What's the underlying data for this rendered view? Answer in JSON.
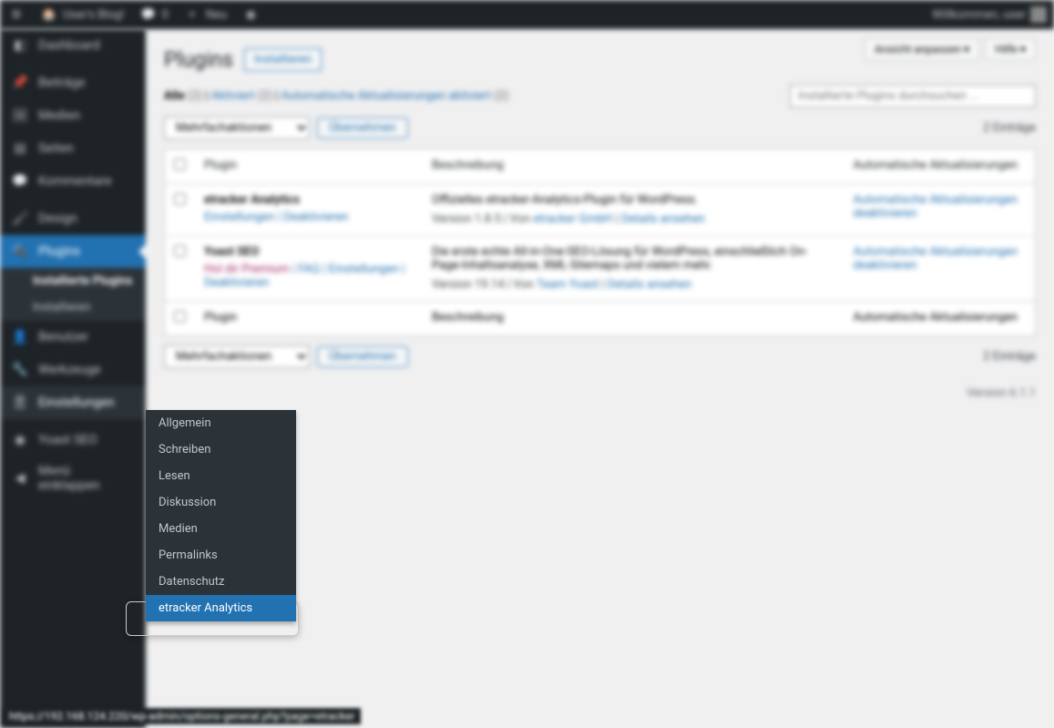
{
  "adminbar": {
    "site_name": "User's Blog!",
    "comments_count": "0",
    "new_label": "Neu",
    "welcome": "Willkommen, user"
  },
  "sidebar": {
    "items": [
      {
        "label": "Dashboard",
        "icon": "dashboard"
      },
      {
        "label": "Beiträge",
        "icon": "posts"
      },
      {
        "label": "Medien",
        "icon": "media"
      },
      {
        "label": "Seiten",
        "icon": "pages"
      },
      {
        "label": "Kommentare",
        "icon": "comments"
      },
      {
        "label": "Design",
        "icon": "appearance"
      },
      {
        "label": "Plugins",
        "icon": "plugins",
        "active": true
      },
      {
        "label": "Benutzer",
        "icon": "users"
      },
      {
        "label": "Werkzeuge",
        "icon": "tools"
      },
      {
        "label": "Einstellungen",
        "icon": "settings",
        "open": true
      },
      {
        "label": "Yoast SEO",
        "icon": "yoast"
      },
      {
        "label": "Menü einklappen",
        "icon": "collapse"
      }
    ],
    "plugins_submenu": [
      {
        "label": "Installierte Plugins",
        "current": true
      },
      {
        "label": "Installieren"
      }
    ]
  },
  "flyout": {
    "items": [
      {
        "label": "Allgemein"
      },
      {
        "label": "Schreiben"
      },
      {
        "label": "Lesen"
      },
      {
        "label": "Diskussion"
      },
      {
        "label": "Medien"
      },
      {
        "label": "Permalinks"
      },
      {
        "label": "Datenschutz"
      },
      {
        "label": "etracker Analytics",
        "highlight": true
      }
    ]
  },
  "header": {
    "screen_options": "Ansicht anpassen ▾",
    "help": "Hilfe ▾",
    "title": "Plugins",
    "install_btn": "Installieren"
  },
  "filters": {
    "all_label": "Alle",
    "all_count": "(2)",
    "active_label": "Aktiviert",
    "active_count": "(2)",
    "auto_label": "Automatische Aktualisierungen aktiviert",
    "auto_count": "(2)"
  },
  "search": {
    "placeholder": "Installierte Plugins durchsuchen ..."
  },
  "bulk": {
    "select_label": "Mehrfachaktionen",
    "apply_label": "Übernehmen"
  },
  "table": {
    "col_plugin": "Plugin",
    "col_desc": "Beschreibung",
    "col_auto": "Automatische Aktualisierungen",
    "entries_text": "2 Einträge",
    "rows": [
      {
        "name": "etracker Analytics",
        "actions": "Einstellungen | Deaktivieren",
        "desc": "Offizielles etracker-Analytics-Plugin für WordPress.",
        "meta_prefix": "Version 1.8.5 | Von ",
        "meta_author": "etracker GmbH",
        "meta_sep": " | ",
        "meta_details": "Details ansehen",
        "auto": "Automatische Aktualisierungen deaktivieren"
      },
      {
        "name": "Yoast SEO",
        "premium": "Hol dir Premium",
        "actions_extra": " | FAQ | Einstellungen | Deaktivieren",
        "desc": "Die erste echte All-in-One-SEO-Lösung für WordPress, einschließlich On-Page-Inhaltsanalyse, XML-Sitemaps und vielem mehr.",
        "meta_prefix": "Version 19.14 | Von ",
        "meta_author": "Team Yoast",
        "meta_sep": " | ",
        "meta_details": "Details ansehen",
        "auto": "Automatische Aktualisierungen deaktivieren"
      }
    ]
  },
  "footer": {
    "version": "Version 6.1.1"
  },
  "status_url": "https://192.168.124.220/wp-admin/options-general.php?page=etracker"
}
